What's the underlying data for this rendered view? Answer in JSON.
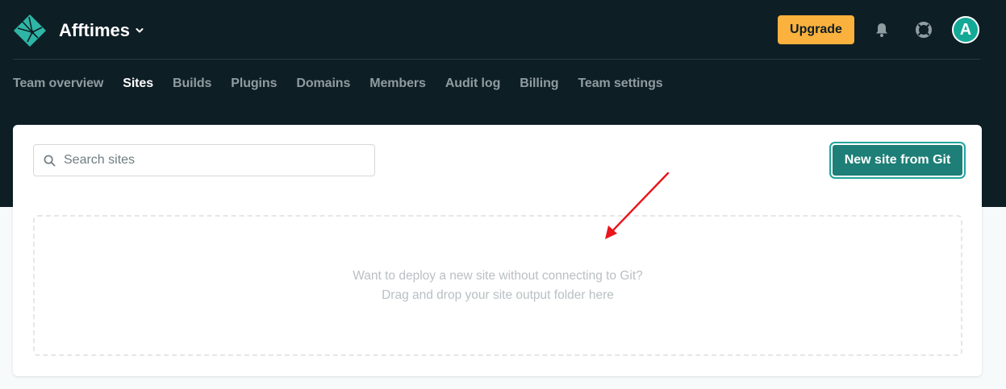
{
  "team": {
    "name": "Afftimes"
  },
  "header": {
    "upgrade_label": "Upgrade",
    "avatar_initial": "A"
  },
  "nav": {
    "items": [
      {
        "label": "Team overview",
        "active": false
      },
      {
        "label": "Sites",
        "active": true
      },
      {
        "label": "Builds",
        "active": false
      },
      {
        "label": "Plugins",
        "active": false
      },
      {
        "label": "Domains",
        "active": false
      },
      {
        "label": "Members",
        "active": false
      },
      {
        "label": "Audit log",
        "active": false
      },
      {
        "label": "Billing",
        "active": false
      },
      {
        "label": "Team settings",
        "active": false
      }
    ]
  },
  "sites": {
    "search_placeholder": "Search sites",
    "search_value": "",
    "new_site_label": "New site from Git",
    "dropzone": {
      "line1": "Want to deploy a new site without connecting to Git?",
      "line2": "Drag and drop your site output folder here"
    }
  },
  "icons": {
    "logo": "netlify-logo-icon",
    "caret": "chevron-down-icon",
    "notifications": "bell-icon",
    "help": "lifebuoy-icon",
    "search": "search-icon",
    "annotation": "red-arrow-icon"
  },
  "colors": {
    "header_bg": "#0e1e25",
    "brand_teal": "#20a69a",
    "upgrade": "#fbb13d",
    "primary_button": "#1d7f77",
    "annotation_arrow": "#e8151b"
  }
}
